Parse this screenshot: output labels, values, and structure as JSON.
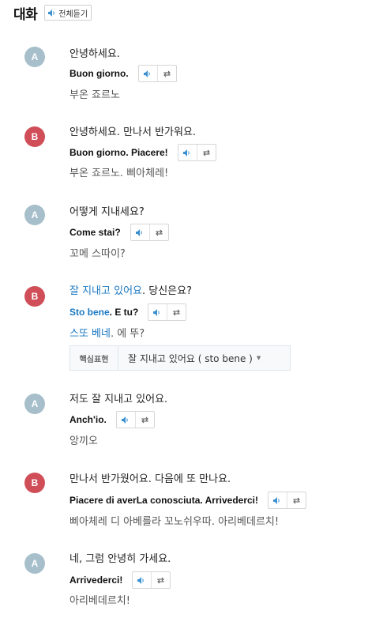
{
  "header": {
    "title": "대화",
    "play_all_label": "전체듣기"
  },
  "colors": {
    "avatar_a": "#a6bfcb",
    "avatar_b": "#d04e58",
    "highlight": "#1a78c2",
    "speaker_icon": "#3a8fd1"
  },
  "icons": {
    "play": "speaker-icon",
    "repeat": "repeat-icon",
    "dropdown": "caret-down-icon"
  },
  "dialogue": [
    {
      "speaker": "A",
      "korean": "안녕하세요.",
      "italian": "Buon giorno.",
      "pronunciation": "부온 죠르노"
    },
    {
      "speaker": "B",
      "korean": "안녕하세요. 만나서 반가워요.",
      "italian": "Buon giorno. Piacere!",
      "pronunciation": "부온 죠르노. 삐아체레!"
    },
    {
      "speaker": "A",
      "korean": "어떻게 지내세요?",
      "italian": "Come stai?",
      "pronunciation": "꼬메 스따이?"
    },
    {
      "speaker": "B",
      "korean_highlight": "잘 지내고 있어요",
      "korean_rest": ". 당신은요?",
      "italian_highlight": "Sto bene",
      "italian_rest": ". E tu?",
      "pron_highlight": "스또 베네",
      "pron_rest": ". 에 뚜?",
      "key_expression": {
        "label": "핵심표현",
        "value": "잘 지내고 있어요 ( sto bene )"
      }
    },
    {
      "speaker": "A",
      "korean": "저도 잘 지내고 있어요.",
      "italian": "Anch'io.",
      "pronunciation": "앙끼오"
    },
    {
      "speaker": "B",
      "korean": "만나서 반가웠어요. 다음에 또 만나요.",
      "italian": "Piacere di averLa conosciuta. Arrivederci!",
      "pronunciation": "삐아체레 디 아베를라 꼬노쉬우따. 아리베데르치!"
    },
    {
      "speaker": "A",
      "korean": "네, 그럼 안녕히 가세요.",
      "italian": "Arrivederci!",
      "pronunciation": "아리베데르치!"
    }
  ]
}
